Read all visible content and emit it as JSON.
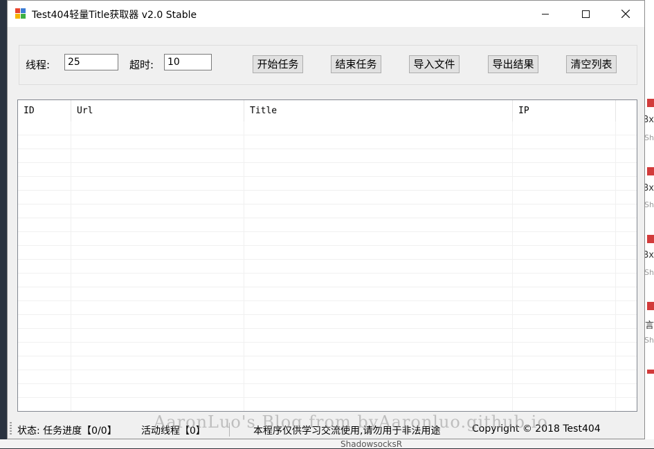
{
  "window": {
    "title": "Test404轻量Title获取器 v2.0 Stable",
    "minimize_icon": "minimize-icon",
    "maximize_icon": "maximize-icon",
    "close_icon": "close-icon"
  },
  "controls": {
    "threads_label": "线程:",
    "threads_value": "25",
    "timeout_label": "超时:",
    "timeout_value": "10",
    "buttons": {
      "start": "开始任务",
      "stop": "结束任务",
      "import": "导入文件",
      "export": "导出结果",
      "clear": "清空列表"
    }
  },
  "table": {
    "columns": [
      "ID",
      "Url",
      "Title",
      "IP"
    ],
    "rows": []
  },
  "status": {
    "state": "状态: 任务进度【0/0】",
    "active_threads": "活动线程【0】",
    "notice": "本程序仅供学习交流使用,请勿用于非法用途",
    "copyright": "Copyright ©  2018 Test404"
  },
  "watermark": "AaronLuo's Blog from byAaronluo.github.io",
  "background": {
    "right_texts": [
      "Bx",
      "Bx",
      "Bx",
      "言",
      "ShadowsocksR"
    ],
    "right_subs": [
      "Sh",
      "Sh",
      "Sh",
      "Sh"
    ]
  },
  "colors": {
    "window_bg": "#f0f0f0",
    "titlebar_bg": "#ffffff",
    "button_bg": "#e1e1e1",
    "accent_red": "#d23b3b"
  }
}
